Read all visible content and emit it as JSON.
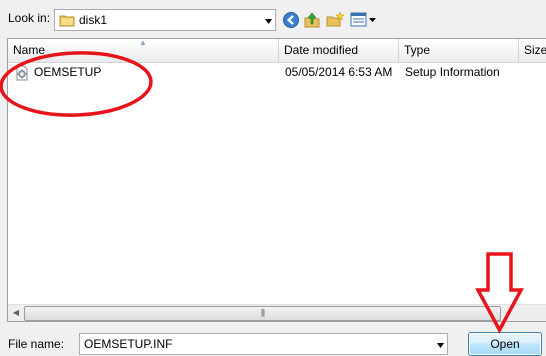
{
  "look_in": {
    "label": "Look in:",
    "value": "disk1"
  },
  "toolbar": {
    "icons": [
      "back-icon",
      "up-folder-icon",
      "new-folder-icon",
      "views-menu-icon"
    ]
  },
  "file_list": {
    "columns": [
      "Name",
      "Date modified",
      "Type",
      "Size"
    ],
    "rows": [
      {
        "name": "OEMSETUP",
        "date": "05/05/2014 6:53 AM",
        "type": "Setup Information",
        "icon": "inf-file-icon"
      }
    ]
  },
  "file_name": {
    "label": "File name:",
    "value": "OEMSETUP.INF"
  },
  "buttons": {
    "open": "Open"
  },
  "annotations": {
    "color": "#e8141c"
  }
}
